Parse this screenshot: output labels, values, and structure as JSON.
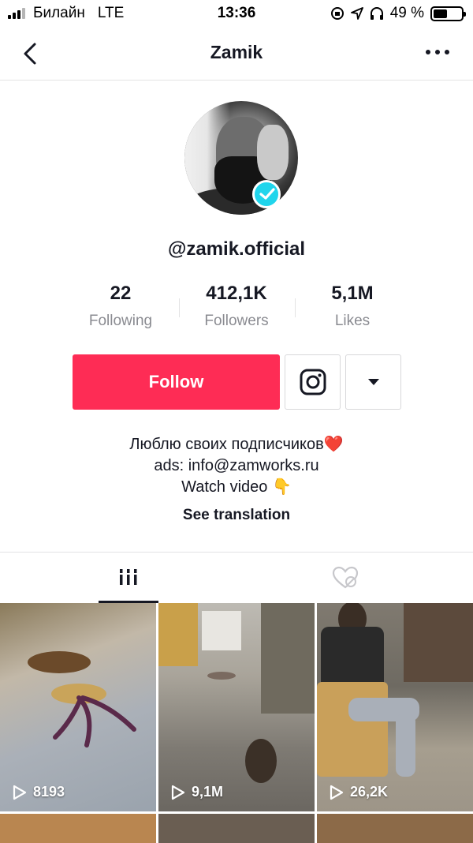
{
  "status_bar": {
    "carrier": "Билайн",
    "network": "LTE",
    "time": "13:36",
    "battery": "49 %",
    "battery_level": 0.49
  },
  "header": {
    "title": "Zamik"
  },
  "profile": {
    "username": "@zamik.official",
    "verified": true,
    "stats": {
      "following": {
        "value": "22",
        "label": "Following"
      },
      "followers": {
        "value": "412,1K",
        "label": "Followers"
      },
      "likes": {
        "value": "5,1M",
        "label": "Likes"
      }
    },
    "follow_label": "Follow",
    "bio": {
      "line1": "Люблю своих подписчиков",
      "line1_emoji": "❤️",
      "line2": "ads: info@zamworks.ru",
      "line3": "Watch video",
      "line3_emoji": "👇"
    },
    "see_translation": "See translation"
  },
  "videos": [
    {
      "views": "8193"
    },
    {
      "views": "9,1M"
    },
    {
      "views": "26,2K"
    }
  ],
  "colors": {
    "accent": "#fe2c55",
    "verified": "#20d5ec",
    "text": "#161823",
    "muted": "#8a8b91"
  }
}
